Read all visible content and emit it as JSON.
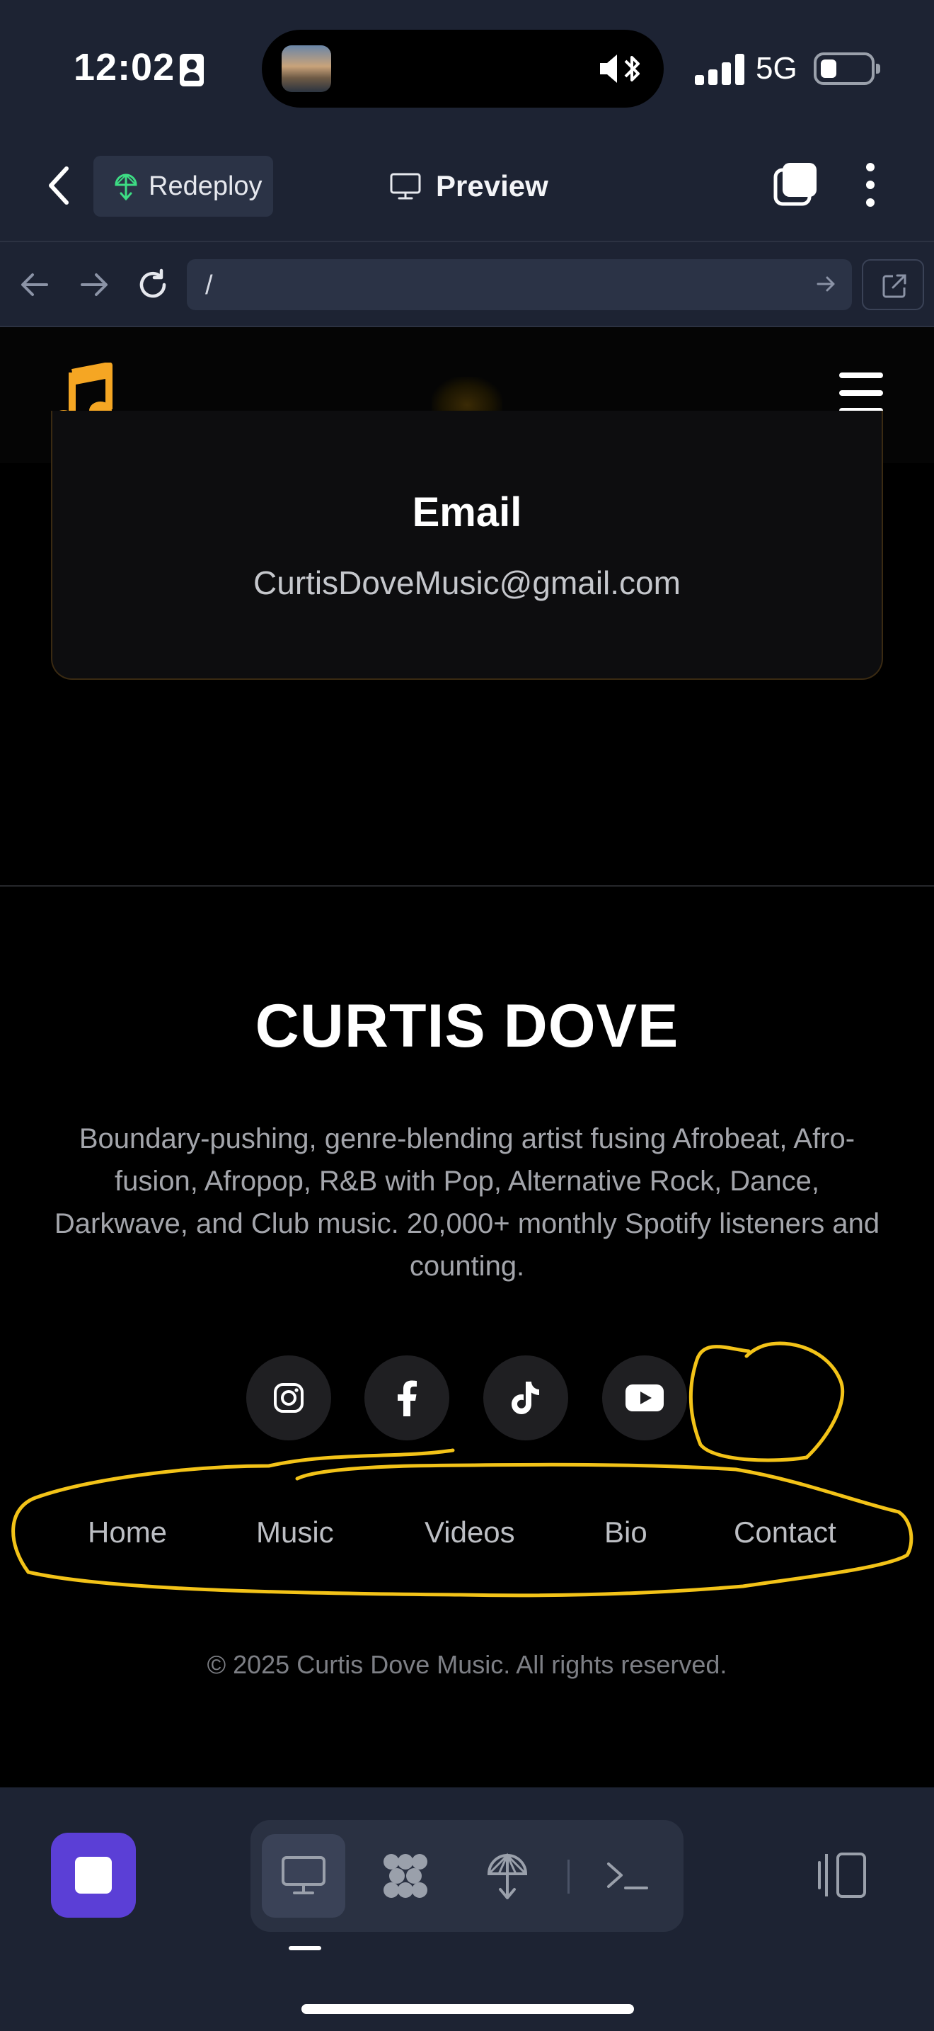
{
  "status_bar": {
    "time": "12:02",
    "network": "5G",
    "icons": [
      "id-card-icon",
      "media-thumbnail-icon",
      "mute-bluetooth-icon",
      "signal-icon",
      "battery-icon"
    ]
  },
  "app_header": {
    "back_icon": "chevron-left-icon",
    "redeploy_label": "Redeploy",
    "redeploy_icon": "deploy-icon",
    "title": "Preview",
    "title_icon": "monitor-icon",
    "tabs_icon": "tabs-icon",
    "more_icon": "more-vertical-icon"
  },
  "browser_bar": {
    "url": "/",
    "icons": [
      "arrow-left-icon",
      "arrow-right-icon",
      "reload-icon",
      "go-arrow-icon",
      "open-external-icon"
    ]
  },
  "site": {
    "logo_icon": "music-note-icon",
    "menu_icon": "hamburger-icon",
    "accent_color": "#f5a623",
    "email_card": {
      "title": "Email",
      "value": "CurtisDoveMusic@gmail.com"
    },
    "footer": {
      "brand": "CURTIS DOVE",
      "bio": "Boundary-pushing, genre-blending artist fusing Afrobeat, Afro-fusion, Afropop, R&B with Pop, Alternative Rock, Dance, Darkwave, and Club music. 20,000+ monthly Spotify listeners and counting.",
      "social_icons": [
        "instagram-icon",
        "facebook-icon",
        "tiktok-icon",
        "youtube-icon"
      ],
      "nav": [
        "Home",
        "Music",
        "Videos",
        "Bio",
        "Contact"
      ],
      "copyright": "© 2025 Curtis Dove Music. All rights reserved."
    },
    "annotation_color": "#f3c318"
  },
  "bottom_toolbar": {
    "stop_color": "#5b3fd6",
    "modes": [
      "desktop-preview-icon",
      "agent-icon",
      "deploy-icon",
      "terminal-icon"
    ],
    "active_mode": "desktop-preview-icon",
    "split_icon": "split-view-icon"
  }
}
